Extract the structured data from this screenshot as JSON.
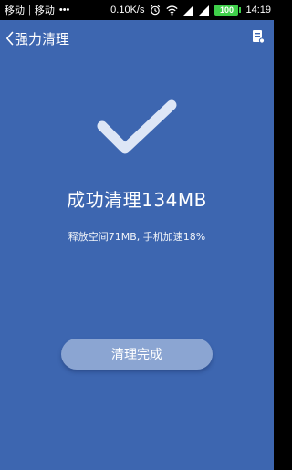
{
  "status_bar": {
    "carrier1": "移动",
    "separator": "|",
    "carrier2": "移动",
    "dots": "•••",
    "net_speed": "0.10K/s",
    "battery_level": "100",
    "time": "14:19",
    "icons": [
      "alarm-icon",
      "wifi-icon",
      "signal-icon",
      "signal-icon"
    ]
  },
  "header": {
    "title": "强力清理",
    "back_icon": "chevron-left-icon",
    "right_icon": "report-icon"
  },
  "result": {
    "title": "成功清理134MB",
    "subtitle": "释放空间71MB, 手机加速18%"
  },
  "done_button": {
    "label": "清理完成"
  },
  "colors": {
    "background": "#3d66b0",
    "button": "#8ba5d2",
    "check": "#dde6f6",
    "battery": "#3fcf4a"
  }
}
